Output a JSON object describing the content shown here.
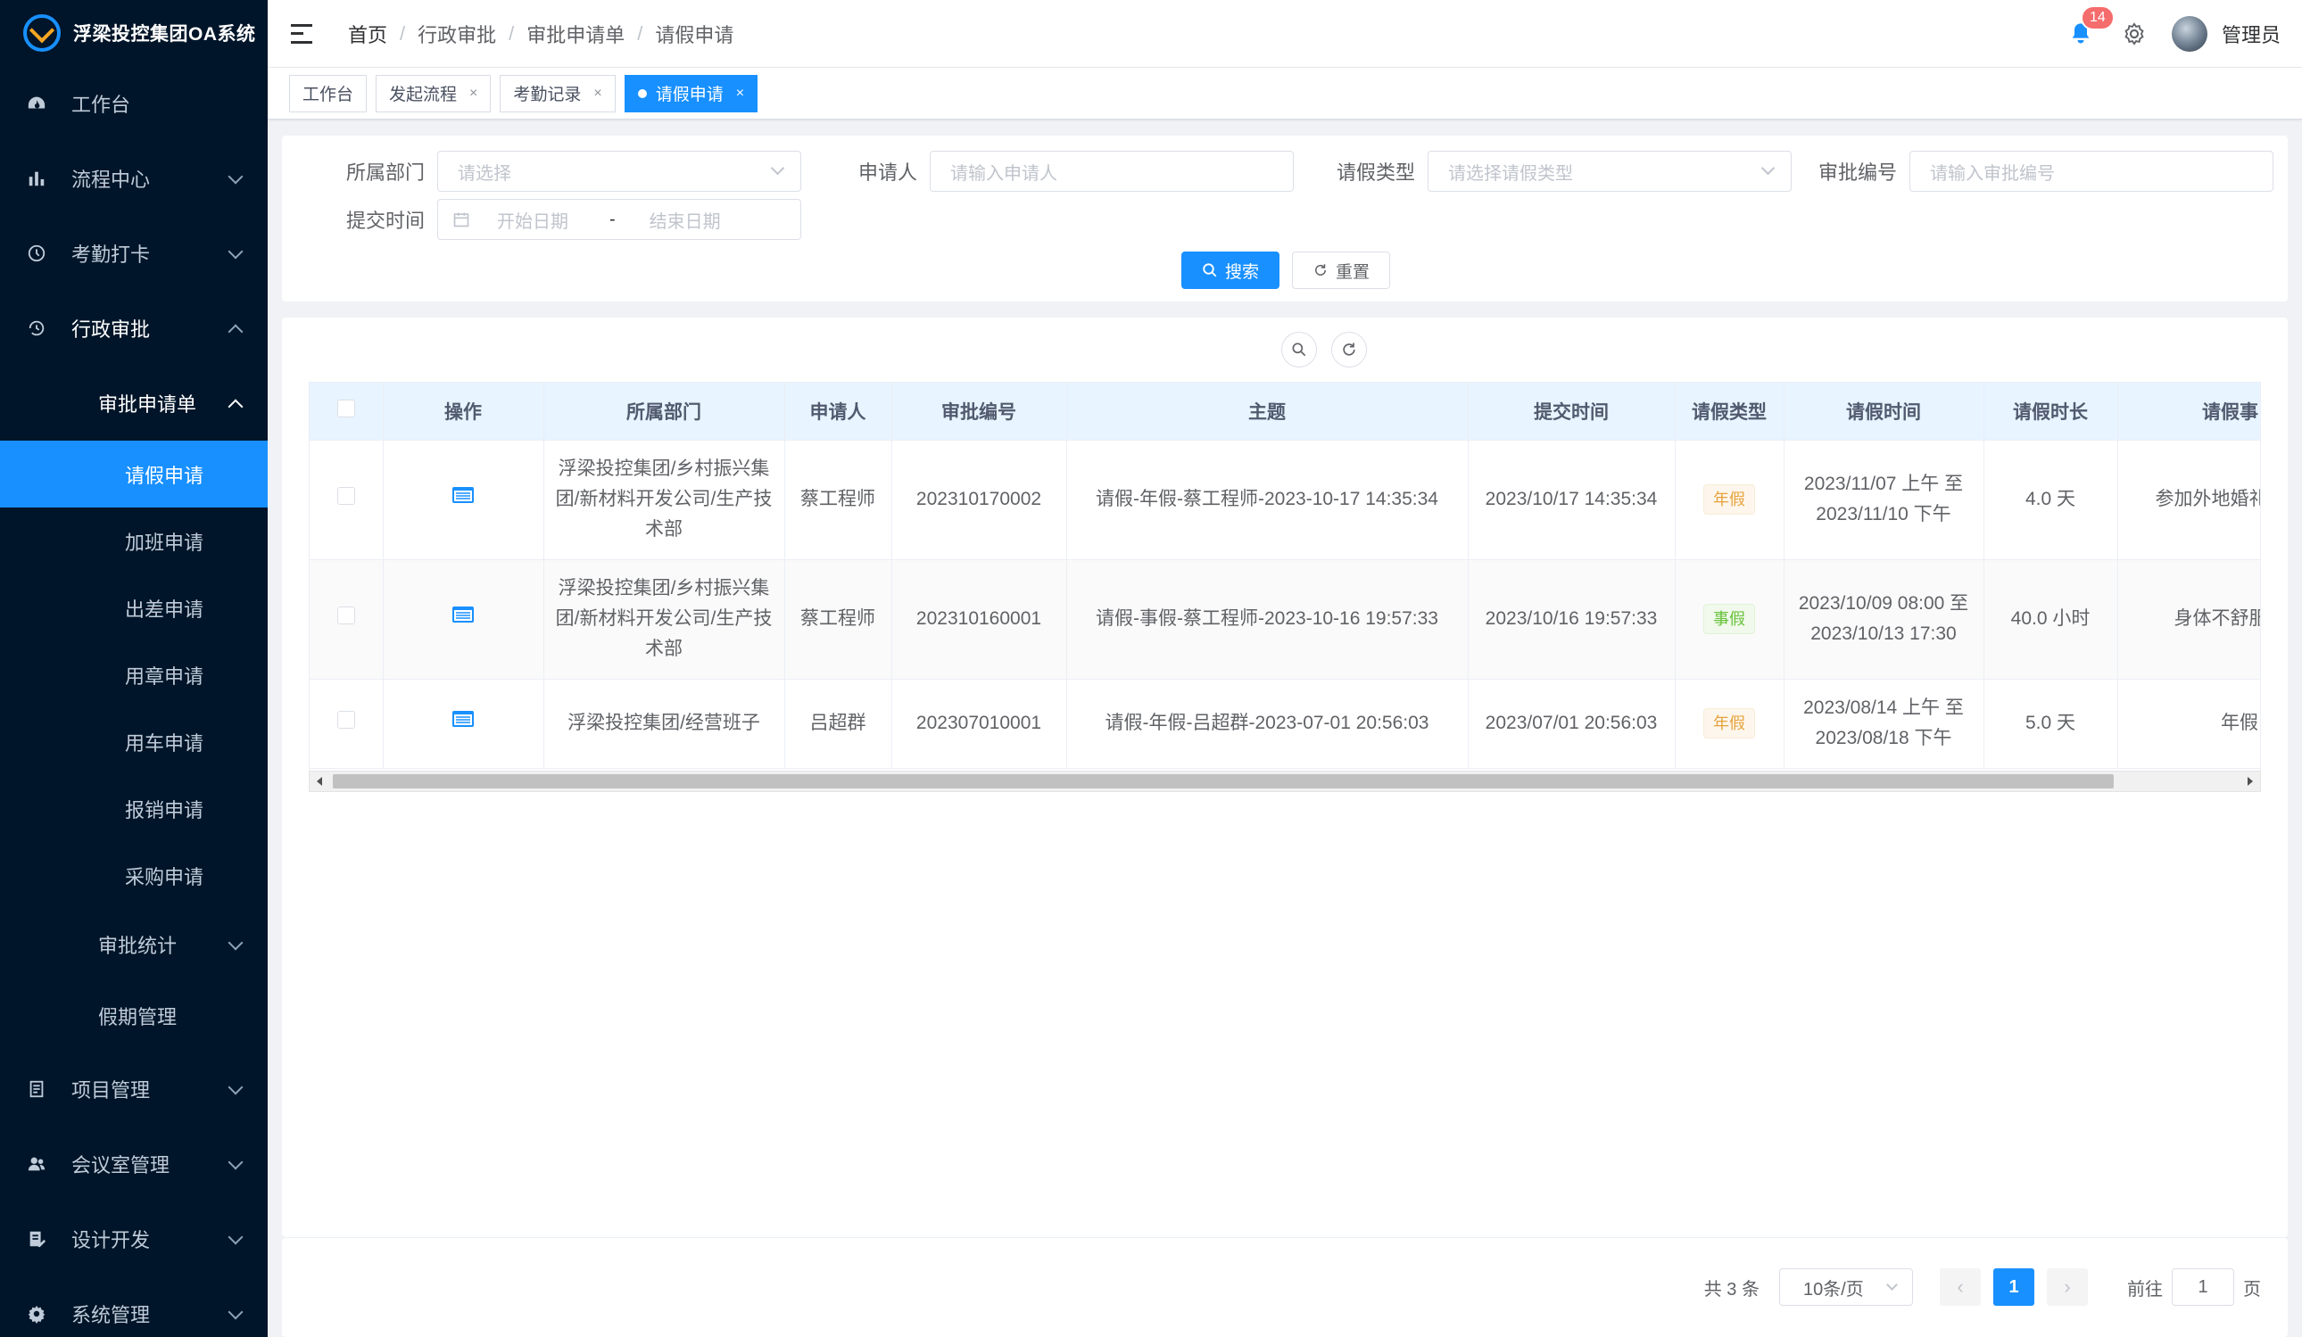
{
  "app": {
    "title": "浮梁投控集团OA系统"
  },
  "sidebar": {
    "items": [
      {
        "label": "工作台",
        "icon": "dashboard-icon"
      },
      {
        "label": "流程中心",
        "icon": "bar-chart-icon"
      },
      {
        "label": "考勤打卡",
        "icon": "clock-icon"
      },
      {
        "label": "行政审批",
        "icon": "history-icon"
      },
      {
        "label": "项目管理",
        "icon": "document-icon"
      },
      {
        "label": "会议室管理",
        "icon": "users-icon"
      },
      {
        "label": "设计开发",
        "icon": "edit-doc-icon"
      },
      {
        "label": "系统管理",
        "icon": "gear-icon"
      }
    ],
    "sub_group": "审批申请单",
    "leaves": [
      "请假申请",
      "加班申请",
      "出差申请",
      "用章申请",
      "用车申请",
      "报销申请",
      "采购申请"
    ],
    "sub2": [
      "审批统计",
      "假期管理"
    ],
    "active_color": "#1890ff"
  },
  "header": {
    "breadcrumb": [
      "首页",
      "行政审批",
      "审批申请单",
      "请假申请"
    ],
    "notification_count": "14",
    "user_name": "管理员"
  },
  "tags": [
    {
      "label": "工作台",
      "closable": false
    },
    {
      "label": "发起流程",
      "closable": true
    },
    {
      "label": "考勤记录",
      "closable": true
    },
    {
      "label": "请假申请",
      "closable": true,
      "active": true
    }
  ],
  "tag_close_glyph": "×",
  "search": {
    "dept_label": "所属部门",
    "dept_placeholder": "请选择",
    "applicant_label": "申请人",
    "applicant_placeholder": "请输入申请人",
    "type_label": "请假类型",
    "type_placeholder": "请选择请假类型",
    "code_label": "审批编号",
    "code_placeholder": "请输入审批编号",
    "time_label": "提交时间",
    "start_placeholder": "开始日期",
    "range_sep": "-",
    "end_placeholder": "结束日期",
    "search_btn": "搜索",
    "reset_btn": "重置"
  },
  "table": {
    "columns": [
      "操作",
      "所属部门",
      "申请人",
      "审批编号",
      "主题",
      "提交时间",
      "请假类型",
      "请假时间",
      "请假时长",
      "请假事由"
    ],
    "rows": [
      {
        "dept": "浮梁投控集团/乡村振兴集团/新材料开发公司/生产技术部",
        "applicant": "蔡工程师",
        "code": "202310170002",
        "subject": "请假-年假-蔡工程师-2023-10-17 14:35:34",
        "submit_time": "2023/10/17 14:35:34",
        "type": "年假",
        "type_color": "yellow",
        "leave_time_1": "2023/11/07 上午 至",
        "leave_time_2": "2023/11/10 下午",
        "duration": "4.0 天",
        "reason": "参加外地婚礼请休假"
      },
      {
        "dept": "浮梁投控集团/乡村振兴集团/新材料开发公司/生产技术部",
        "applicant": "蔡工程师",
        "code": "202310160001",
        "subject": "请假-事假-蔡工程师-2023-10-16 19:57:33",
        "submit_time": "2023/10/16 19:57:33",
        "type": "事假",
        "type_color": "green",
        "leave_time_1": "2023/10/09 08:00 至",
        "leave_time_2": "2023/10/13 17:30",
        "duration": "40.0 小时",
        "reason": "身体不舒服请假"
      },
      {
        "dept": "浮梁投控集团/经营班子",
        "applicant": "吕超群",
        "code": "202307010001",
        "subject": "请假-年假-吕超群-2023-07-01 20:56:03",
        "submit_time": "2023/07/01 20:56:03",
        "type": "年假",
        "type_color": "yellow",
        "leave_time_1": "2023/08/14 上午 至",
        "leave_time_2": "2023/08/18 下午",
        "duration": "5.0 天",
        "reason": "年假"
      }
    ]
  },
  "pagination": {
    "total": "共 3 条",
    "page_size": "10条/页",
    "prev": "‹",
    "current": "1",
    "next": "›",
    "goto_label": "前往",
    "goto_value": "1",
    "goto_suffix": "页"
  }
}
